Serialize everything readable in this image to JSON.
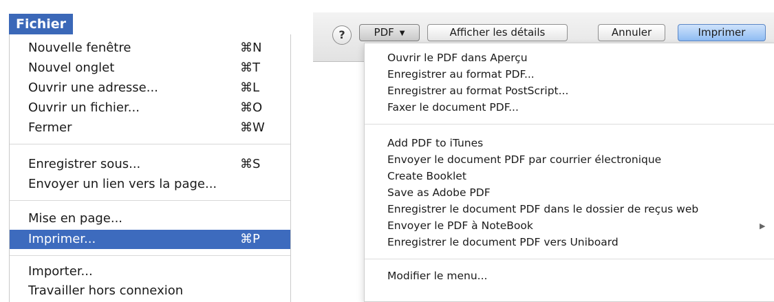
{
  "file_menu": {
    "title": "Fichier",
    "groups": [
      [
        {
          "label": "Nouvelle fenêtre",
          "shortcut": "⌘N"
        },
        {
          "label": "Nouvel onglet",
          "shortcut": "⌘T"
        },
        {
          "label": "Ouvrir une adresse...",
          "shortcut": "⌘L"
        },
        {
          "label": "Ouvrir un fichier...",
          "shortcut": "⌘O"
        },
        {
          "label": "Fermer",
          "shortcut": "⌘W"
        }
      ],
      [
        {
          "label": "Enregistrer sous...",
          "shortcut": "⌘S"
        },
        {
          "label": "Envoyer un lien vers la page...",
          "shortcut": ""
        }
      ],
      [
        {
          "label": "Mise en page...",
          "shortcut": ""
        },
        {
          "label": "Imprimer...",
          "shortcut": "⌘P",
          "selected": true
        }
      ],
      [
        {
          "label": "Importer...",
          "shortcut": ""
        },
        {
          "label": "Travailler hors connexion",
          "shortcut": ""
        }
      ]
    ]
  },
  "print_dialog": {
    "help_label": "?",
    "pdf_button": "PDF",
    "pdf_arrow": "▼",
    "details_button": "Afficher les détails",
    "cancel_button": "Annuler",
    "print_button": "Imprimer",
    "accent_color": "#8fbcf3"
  },
  "pdf_menu": {
    "groups": [
      [
        {
          "label": "Ouvrir le PDF dans Aperçu"
        },
        {
          "label": "Enregistrer au format PDF..."
        },
        {
          "label": "Enregistrer au format PostScript..."
        },
        {
          "label": "Faxer le document PDF..."
        }
      ],
      [
        {
          "label": "Add PDF to iTunes"
        },
        {
          "label": "Envoyer le document PDF par courrier électronique"
        },
        {
          "label": "Create Booklet"
        },
        {
          "label": "Save as Adobe PDF"
        },
        {
          "label": "Enregistrer le document PDF dans le dossier de reçus web"
        },
        {
          "label": "Envoyer le PDF à NoteBook",
          "submenu": true
        },
        {
          "label": "Enregistrer le document PDF vers Uniboard"
        }
      ],
      [
        {
          "label": "Modifier le menu..."
        }
      ]
    ],
    "submenu_arrow": "▶"
  },
  "colors": {
    "menu_highlight": "#3d6bbe",
    "menu_title_bg": "#3b68b8"
  }
}
